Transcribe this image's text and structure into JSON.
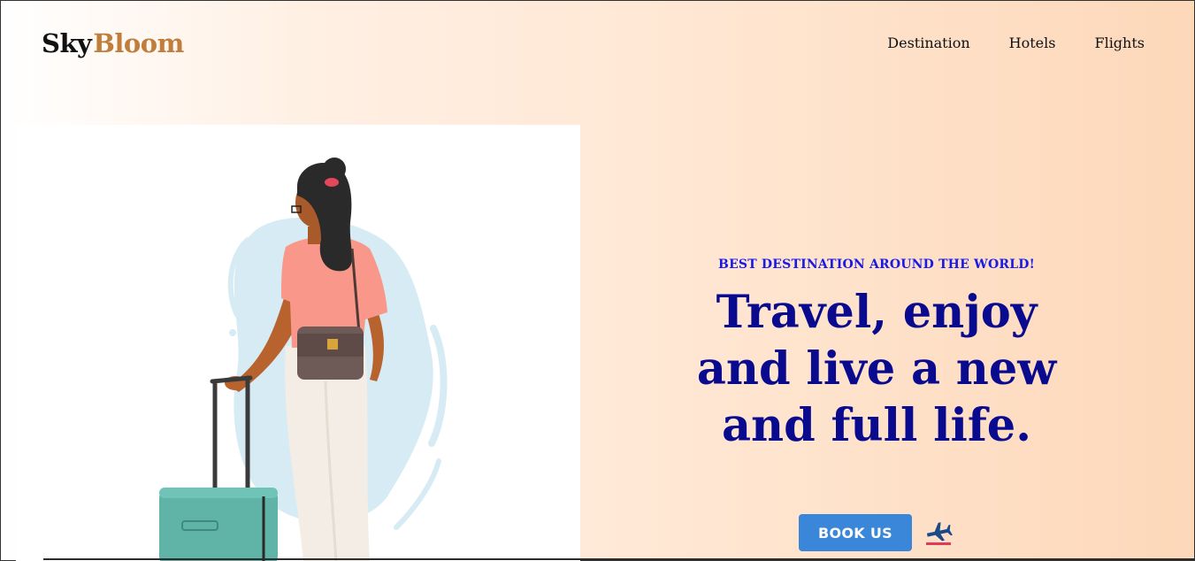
{
  "brand": {
    "name_part1": "Sky",
    "name_part2": "Bloom",
    "accent_color": "#c07d3c"
  },
  "nav": {
    "items": [
      {
        "label": "Destination"
      },
      {
        "label": "Hotels"
      },
      {
        "label": "Flights"
      }
    ]
  },
  "hero": {
    "tagline": "BEST DESTINATION AROUND THE WORLD!",
    "headline_line1": "Travel, enjoy",
    "headline_line2": "and live a new",
    "headline_line3": "and full life.",
    "illustration": "traveler-woman-with-suitcase-illustration",
    "cta": {
      "label": "BOOK US",
      "icon": "airplane-icon",
      "color": "#3a86d8"
    },
    "headline_color": "#0a0a8f",
    "tagline_color": "#1a1ae6"
  }
}
